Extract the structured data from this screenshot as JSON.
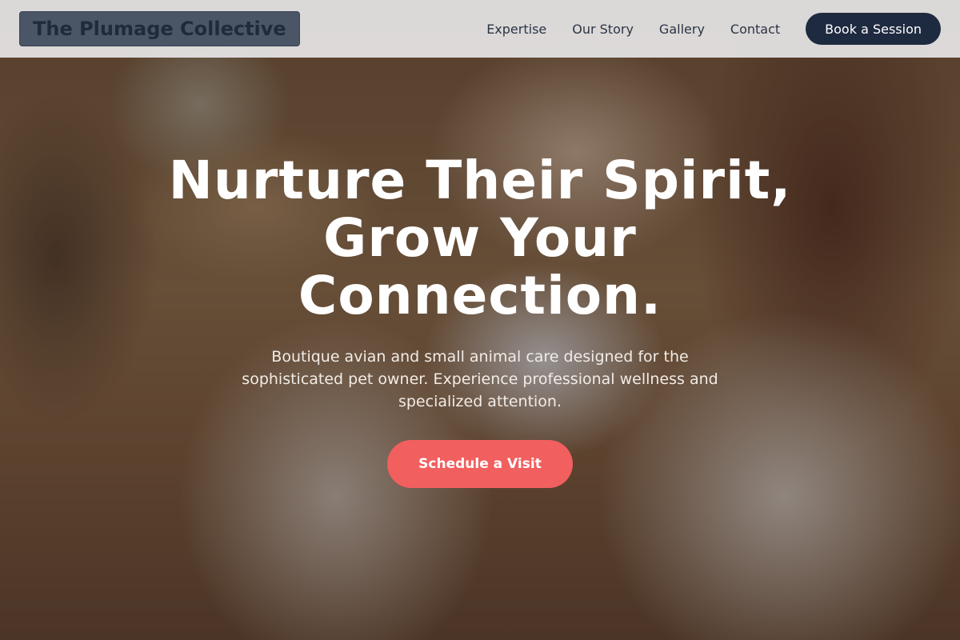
{
  "brand": {
    "name": "The Plumage Collective"
  },
  "nav": {
    "links": [
      "Expertise",
      "Our Story",
      "Gallery",
      "Contact"
    ],
    "cta_label": "Book a Session"
  },
  "hero": {
    "title_lines": [
      "Nurture Their Spirit,",
      "Grow Your",
      "Connection."
    ],
    "subtitle": "Boutique avian and small animal care designed for the sophisticated pet owner. Experience professional wellness and specialized attention.",
    "cta_label": "Schedule a Visit"
  },
  "colors": {
    "header_bg": "#eeeef0",
    "logo_bg": "#4a5566",
    "nav_cta_bg": "#1e2a40",
    "hero_cta_bg": "#f25f5f"
  }
}
